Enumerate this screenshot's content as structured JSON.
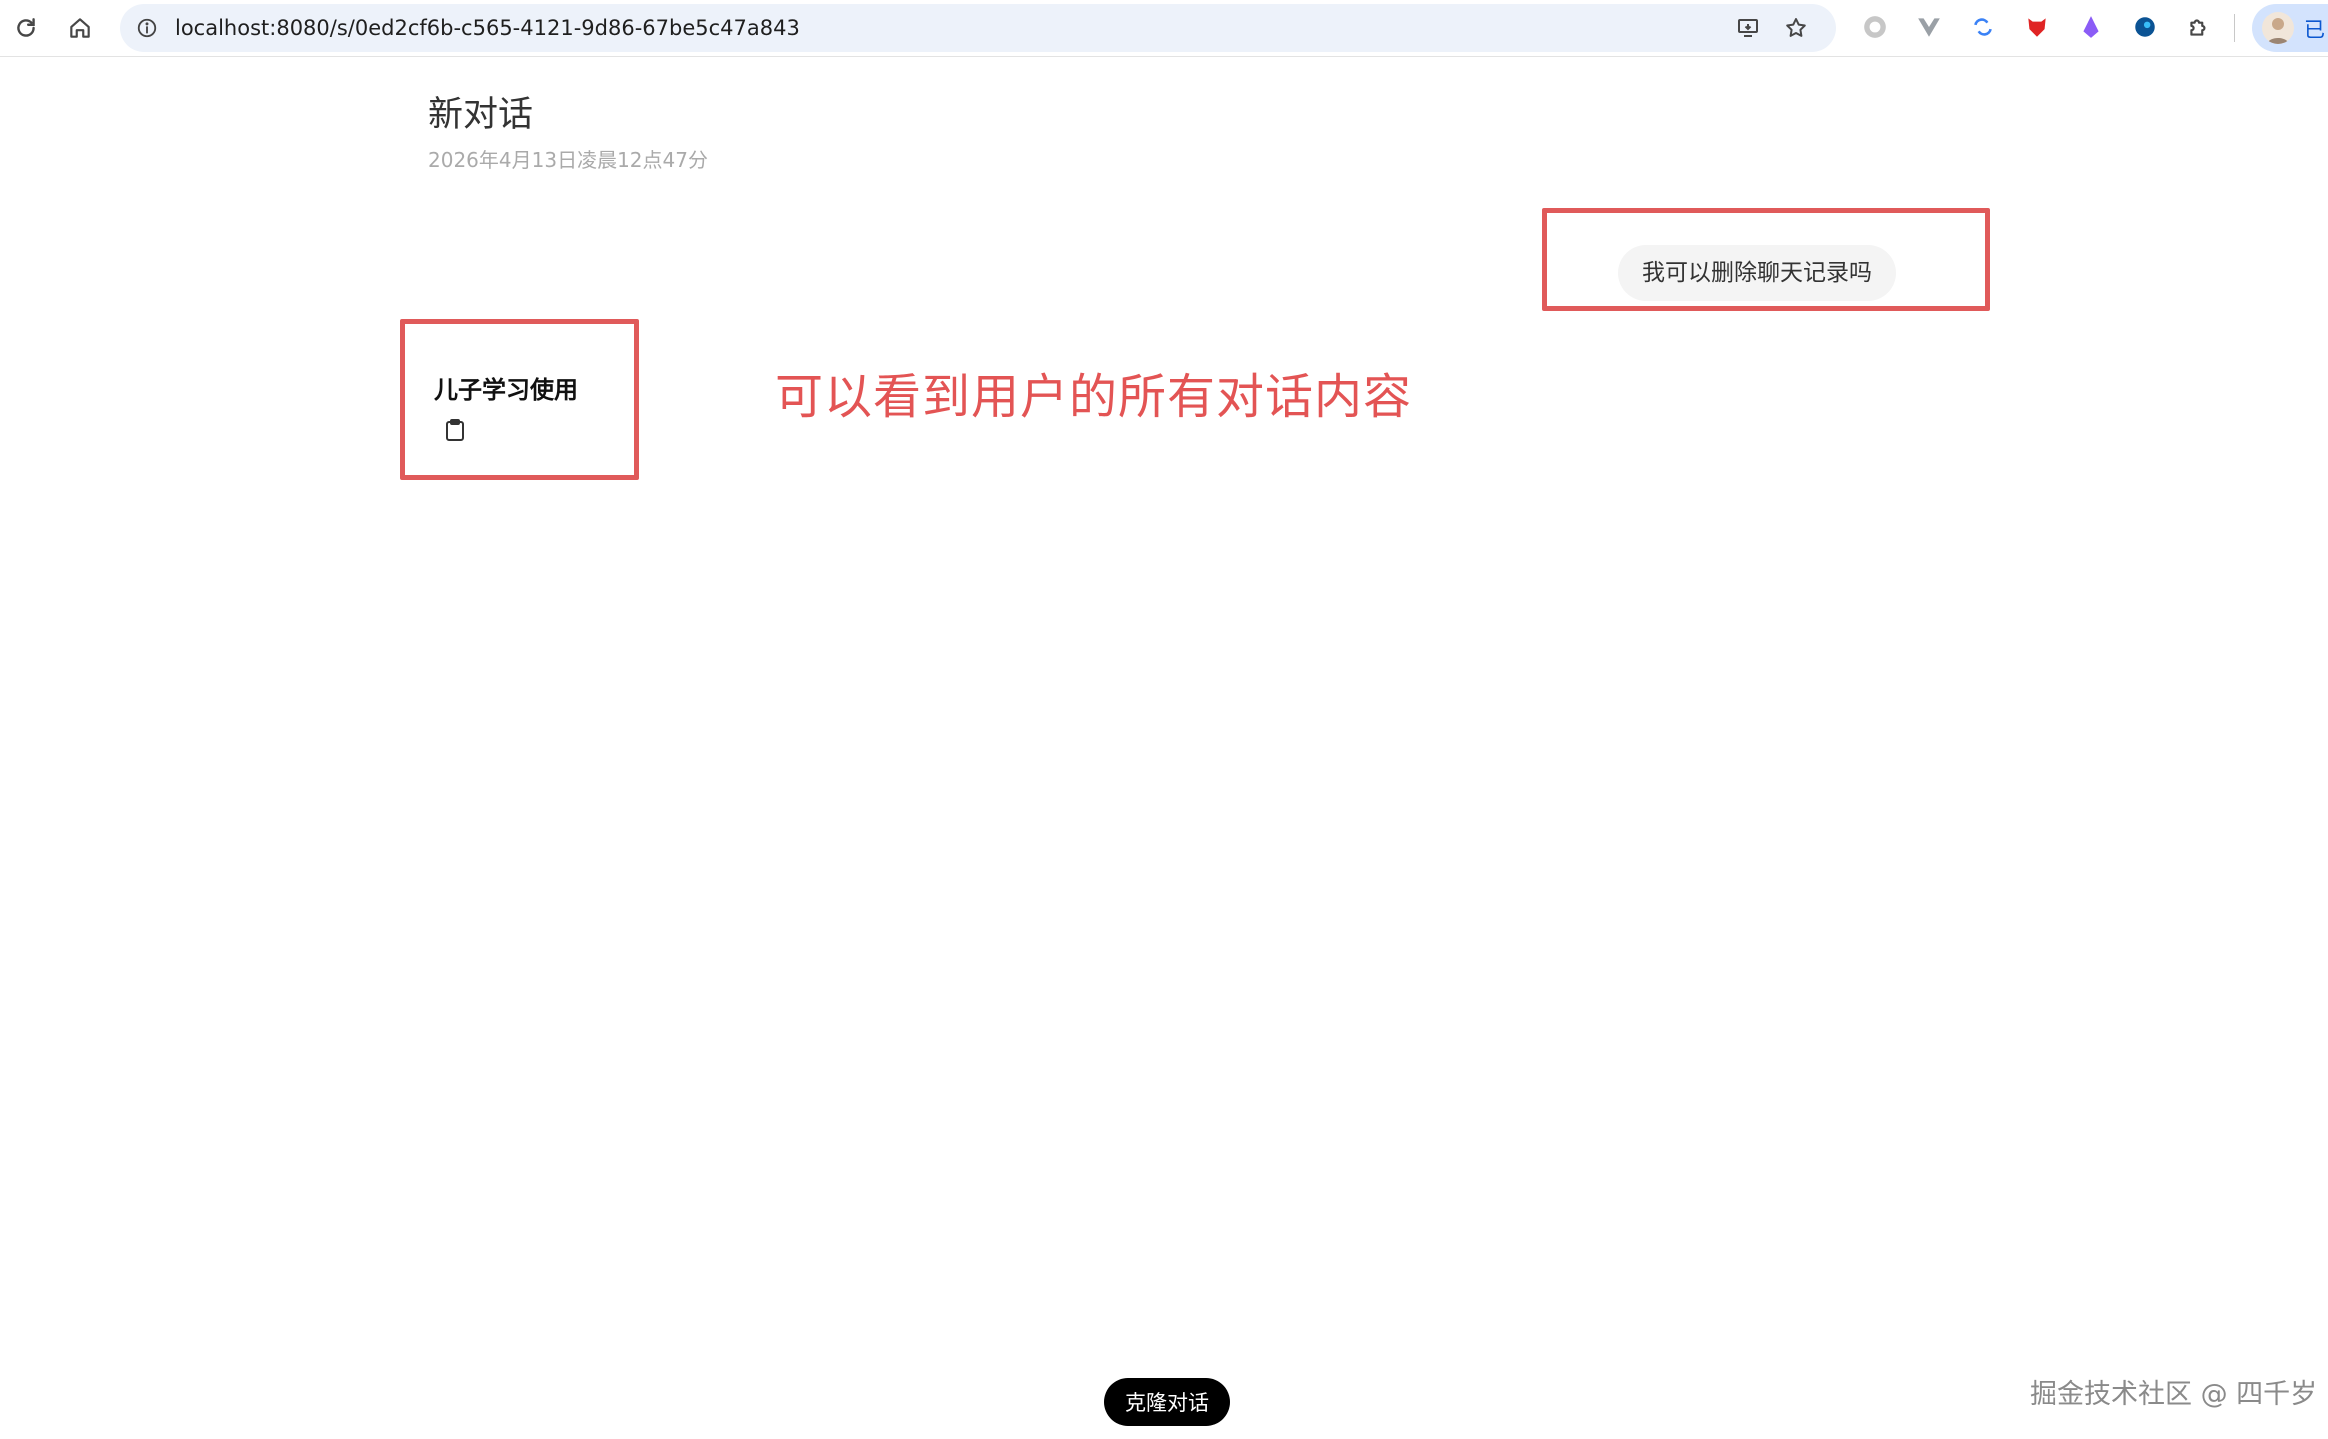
{
  "browser": {
    "url": "localhost:8080/s/0ed2cf6b-c565-4121-9d86-67be5c47a843",
    "profile_label": "已"
  },
  "conversation": {
    "title": "新对话",
    "date": "2026年4月13日凌晨12点47分",
    "user_message": "我可以删除聊天记录吗",
    "assistant_message": "儿子学习使用"
  },
  "annotation": {
    "text": "可以看到用户的所有对话内容",
    "color": "#e35454",
    "box_color": "#e05a5a"
  },
  "actions": {
    "clone_label": "克隆对话"
  },
  "watermark": {
    "text": "掘金技术社区 @ 四千岁"
  },
  "icons": [
    "reload-icon",
    "home-icon",
    "site-info-icon",
    "install-app-icon",
    "bookmark-star-icon",
    "extension-icons",
    "puzzle-icon",
    "copy-icon"
  ]
}
